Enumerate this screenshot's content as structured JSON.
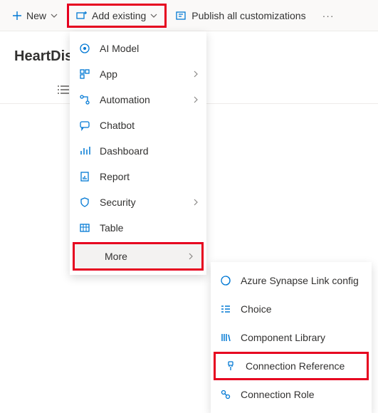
{
  "toolbar": {
    "new_label": "New",
    "add_existing_label": "Add existing",
    "publish_label": "Publish all customizations"
  },
  "page": {
    "title_partial": "HeartDise"
  },
  "dropdown": {
    "items": [
      {
        "label": "AI Model",
        "icon": "ai-model",
        "submenu": false
      },
      {
        "label": "App",
        "icon": "app",
        "submenu": true
      },
      {
        "label": "Automation",
        "icon": "automation",
        "submenu": true
      },
      {
        "label": "Chatbot",
        "icon": "chatbot",
        "submenu": false
      },
      {
        "label": "Dashboard",
        "icon": "dashboard",
        "submenu": false
      },
      {
        "label": "Report",
        "icon": "report",
        "submenu": false
      },
      {
        "label": "Security",
        "icon": "security",
        "submenu": true
      },
      {
        "label": "Table",
        "icon": "table",
        "submenu": false
      }
    ],
    "more_label": "More"
  },
  "submenu": {
    "items": [
      {
        "label": "Azure Synapse Link config",
        "icon": "synapse"
      },
      {
        "label": "Choice",
        "icon": "choice"
      },
      {
        "label": "Component Library",
        "icon": "library"
      },
      {
        "label": "Connection Reference",
        "icon": "connection-ref",
        "highlight": true
      },
      {
        "label": "Connection Role",
        "icon": "connection-role"
      }
    ]
  }
}
